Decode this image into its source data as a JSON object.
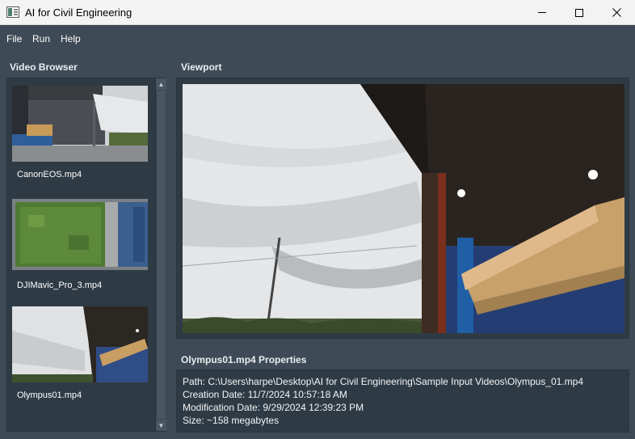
{
  "window": {
    "title": "AI for Civil Engineering",
    "controls": [
      "minimize",
      "maximize",
      "close"
    ]
  },
  "menu": {
    "file": "File",
    "run": "Run",
    "help": "Help"
  },
  "browser": {
    "title": "Video Browser",
    "videos": [
      {
        "label": "CanonEOS.mp4"
      },
      {
        "label": "DJIMavic_Pro_3.mp4"
      },
      {
        "label": "Olympus01.mp4"
      }
    ]
  },
  "viewport": {
    "title": "Viewport"
  },
  "properties": {
    "title": "Olympus01.mp4 Properties",
    "path": "Path: C:\\Users\\harpe\\Desktop\\AI for Civil Engineering\\Sample Input Videos\\Olympus_01.mp4",
    "creation": "Creation Date: 11/7/2024 10:57:18 AM",
    "modification": "Modification Date: 9/29/2024 12:39:23 PM",
    "size": "Size: ~158 megabytes"
  },
  "colors": {
    "background": "#3e4a55",
    "panel": "#2f3b44",
    "titlebar": "#f3f3f3"
  }
}
